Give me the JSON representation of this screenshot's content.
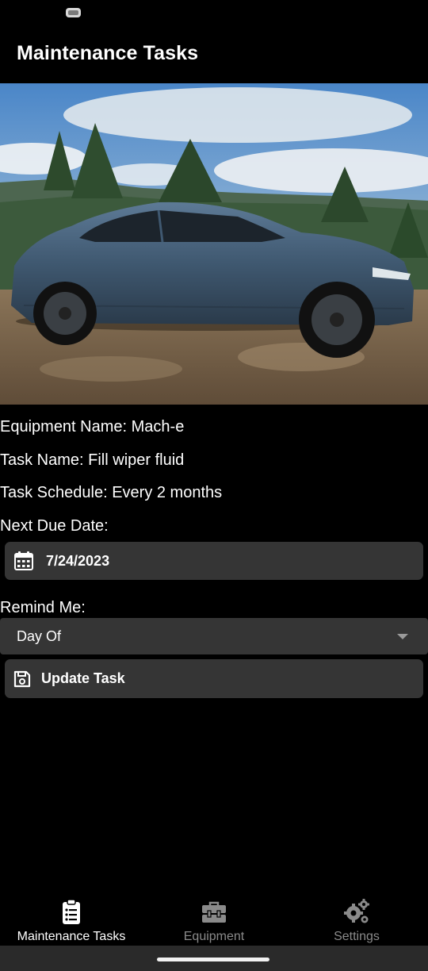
{
  "status_bar": {
    "icon": "notification-icon"
  },
  "app": {
    "title": "Maintenance Tasks"
  },
  "hero": {
    "icon": "car-photo"
  },
  "details": {
    "equipment_line": "Equipment Name: Mach-e",
    "task_line": "Task Name: Fill wiper fluid",
    "schedule_line": "Task Schedule: Every 2 months",
    "next_due_label": "Next Due Date:",
    "next_due_value": "7/24/2023",
    "remind_label": "Remind Me:",
    "remind_value": "Day Of",
    "update_label": "Update Task"
  },
  "nav": {
    "items": [
      {
        "label": "Maintenance Tasks",
        "icon": "clipboard-list-icon",
        "active": true
      },
      {
        "label": "Equipment",
        "icon": "toolbox-icon",
        "active": false
      },
      {
        "label": "Settings",
        "icon": "gears-icon",
        "active": false
      }
    ]
  },
  "colors": {
    "background": "#000000",
    "field": "#353535",
    "inactive": "#8a8a8a"
  }
}
